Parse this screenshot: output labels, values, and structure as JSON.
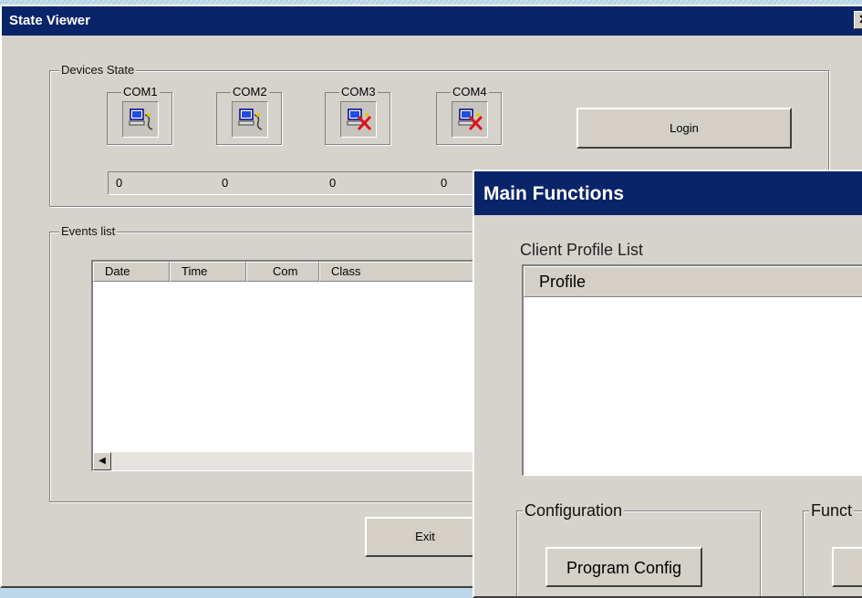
{
  "state_viewer": {
    "title": "State Viewer",
    "close_glyph": "✕",
    "devices_group_label": "Devices State",
    "ports": [
      {
        "label": "COM1",
        "status": "connected",
        "count": "0"
      },
      {
        "label": "COM2",
        "status": "connected",
        "count": "0"
      },
      {
        "label": "COM3",
        "status": "disconnected",
        "count": "0"
      },
      {
        "label": "COM4",
        "status": "disconnected",
        "count": "0"
      }
    ],
    "login_label": "Login",
    "events_group_label": "Events list",
    "events_columns": [
      "Date",
      "Time",
      "Com",
      "Class"
    ],
    "exit_label": "Exit"
  },
  "main_functions": {
    "title": "Main Functions",
    "client_profile_list_label": "Client Profile List",
    "profile_column": "Profile",
    "configuration_group_label": "Configuration",
    "program_config_label": "Program Config",
    "functions_group_label": "Funct"
  },
  "colors": {
    "title_bar": "#0a246a",
    "window_face": "#d4d0c8",
    "desktop": "#bcd7ea",
    "disconnect_x": "#e0121b"
  },
  "icons": {
    "connected": "computer-connected-icon",
    "disconnected": "computer-disconnected-icon",
    "close": "close-icon",
    "scroll_left": "scroll-left-arrow-icon"
  }
}
